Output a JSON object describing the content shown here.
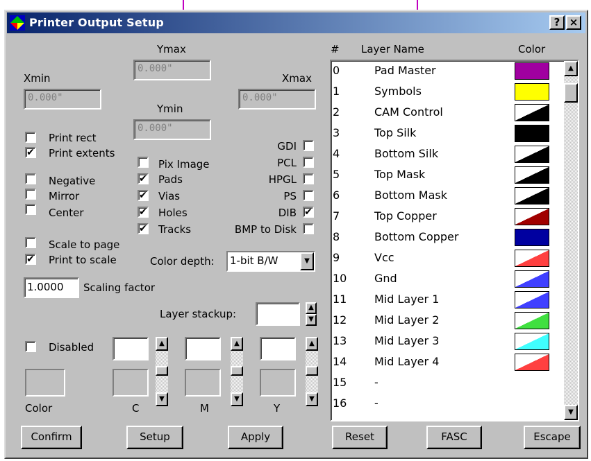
{
  "colors": {
    "title_start": "#08246b",
    "title_end": "#a6caf0",
    "dialog_bg": "#c0c0c0",
    "background_line": "#c000c0"
  },
  "window": {
    "title": "Printer Output Setup",
    "help_label": "?",
    "close_label": "×",
    "icon": "app-icon"
  },
  "bounds": {
    "ymax_label": "Ymax",
    "ymax_value": "0.000\"",
    "xmin_label": "Xmin",
    "xmin_value": "0.000\"",
    "xmax_label": "Xmax",
    "xmax_value": "0.000\"",
    "ymin_label": "Ymin",
    "ymin_value": "0.000\""
  },
  "print_options": [
    {
      "label": "Print rect",
      "checked": false
    },
    {
      "label": "Print extents",
      "checked": true
    },
    {
      "label": "Negative",
      "checked": false
    },
    {
      "label": "Mirror",
      "checked": false
    },
    {
      "label": "Center",
      "checked": false
    },
    {
      "label": "Scale to page",
      "checked": false
    },
    {
      "label": "Print to scale",
      "checked": true
    }
  ],
  "content_options": [
    {
      "label": "Pix Image",
      "checked": false
    },
    {
      "label": "Pads",
      "checked": true
    },
    {
      "label": "Vias",
      "checked": true
    },
    {
      "label": "Holes",
      "checked": true
    },
    {
      "label": "Tracks",
      "checked": true
    }
  ],
  "output_formats": [
    {
      "label": "GDI",
      "checked": false
    },
    {
      "label": "PCL",
      "checked": false
    },
    {
      "label": "HPGL",
      "checked": false
    },
    {
      "label": "PS",
      "checked": false
    },
    {
      "label": "DIB",
      "checked": true
    },
    {
      "label": "BMP to Disk",
      "checked": false
    }
  ],
  "color_depth": {
    "label": "Color depth:",
    "value": "1-bit B/W"
  },
  "scaling": {
    "value": "1.0000",
    "label": "Scaling factor"
  },
  "stackup": {
    "label": "Layer stackup:",
    "value": ""
  },
  "color_mixer": {
    "disabled_label": "Disabled",
    "disabled_checked": false,
    "color_label": "Color",
    "c_label": "C",
    "m_label": "M",
    "y_label": "Y"
  },
  "layer_list": {
    "headers": {
      "num": "#",
      "name": "Layer Name",
      "color": "Color"
    },
    "rows": [
      {
        "num": "0",
        "name": "Pad Master",
        "c1": "#a000a0",
        "c2": "#a000a0"
      },
      {
        "num": "1",
        "name": "Symbols",
        "c1": "#ffff00",
        "c2": "#ffff00"
      },
      {
        "num": "2",
        "name": "CAM Control",
        "c1": "#ffffff",
        "c2": "#000000"
      },
      {
        "num": "3",
        "name": "Top Silk",
        "c1": "#000000",
        "c2": "#000000"
      },
      {
        "num": "4",
        "name": "Bottom Silk",
        "c1": "#ffffff",
        "c2": "#000000"
      },
      {
        "num": "5",
        "name": "Top Mask",
        "c1": "#ffffff",
        "c2": "#000000"
      },
      {
        "num": "6",
        "name": "Bottom Mask",
        "c1": "#ffffff",
        "c2": "#000000"
      },
      {
        "num": "7",
        "name": "Top Copper",
        "c1": "#ffffff",
        "c2": "#a00000"
      },
      {
        "num": "8",
        "name": "Bottom Copper",
        "c1": "#0000a0",
        "c2": "#0000a0"
      },
      {
        "num": "9",
        "name": "Vcc",
        "c1": "#ffffff",
        "c2": "#ff4040"
      },
      {
        "num": "10",
        "name": "Gnd",
        "c1": "#ffffff",
        "c2": "#4040ff"
      },
      {
        "num": "11",
        "name": "Mid Layer 1",
        "c1": "#ffffff",
        "c2": "#4040ff"
      },
      {
        "num": "12",
        "name": "Mid Layer 2",
        "c1": "#ffffff",
        "c2": "#40e040"
      },
      {
        "num": "13",
        "name": "Mid Layer 3",
        "c1": "#ffffff",
        "c2": "#40ffff"
      },
      {
        "num": "14",
        "name": "Mid Layer 4",
        "c1": "#ffffff",
        "c2": "#ff4040"
      },
      {
        "num": "15",
        "name": "-",
        "c1": "",
        "c2": ""
      },
      {
        "num": "16",
        "name": "-",
        "c1": "",
        "c2": ""
      }
    ]
  },
  "buttons": {
    "confirm": "Confirm",
    "setup": "Setup",
    "apply": "Apply",
    "reset": "Reset",
    "fasc": "FASC",
    "escape": "Escape"
  }
}
